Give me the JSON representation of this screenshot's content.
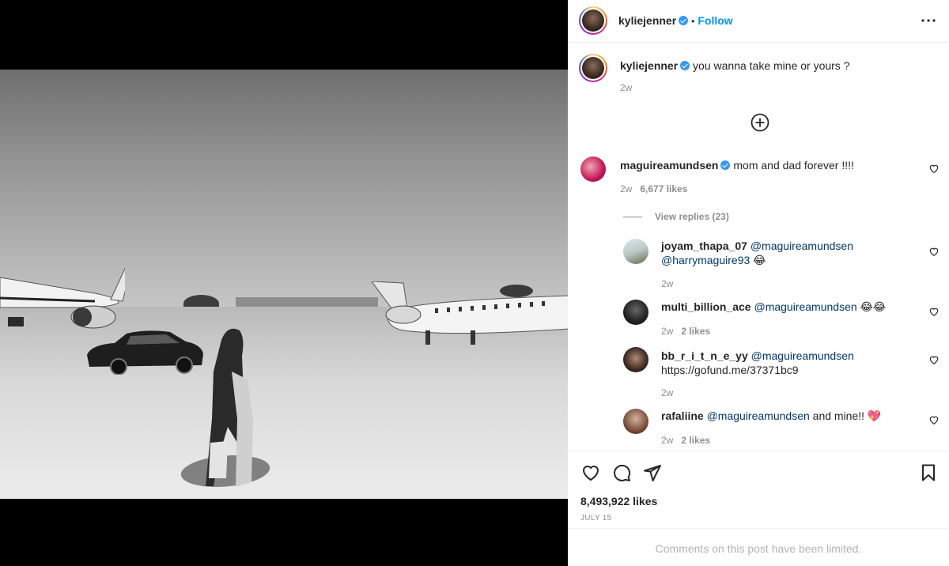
{
  "post": {
    "author": "kyliejenner",
    "follow_label": "Follow",
    "caption": "you wanna take mine or yours ?",
    "caption_age": "2w",
    "likes": "8,493,922 likes",
    "date": "JULY 15",
    "comments_limited": "Comments on this post have been limited."
  },
  "comments": [
    {
      "user": "maguireamundsen",
      "text": "mom and dad forever !!!!",
      "age": "2w",
      "likes": "6,677 likes",
      "view_replies": "View replies (23)"
    }
  ],
  "replies": [
    {
      "user": "joyam_thapa_07",
      "mention1": "@maguireamundsen",
      "mention2": "@harrymaguire93",
      "emoji": "😂",
      "age": "2w",
      "likes": ""
    },
    {
      "user": "multi_billion_ace",
      "mention1": "@maguireamundsen",
      "text": "😂😂",
      "age": "2w",
      "likes": "2 likes"
    },
    {
      "user": "bb_r_i_t_n_e_yy",
      "mention1": "@maguireamundsen",
      "text": "https://gofund.me/37371bc9",
      "age": "2w",
      "likes": ""
    },
    {
      "user": "rafaliine",
      "mention1": "@maguireamundsen",
      "text": "and mine!! 💖",
      "age": "2w",
      "likes": "2 likes"
    }
  ],
  "colors": {
    "accent": "#0095f6",
    "verified": "#3897f0",
    "mention": "#00376b",
    "muted": "#8e8e8e"
  }
}
